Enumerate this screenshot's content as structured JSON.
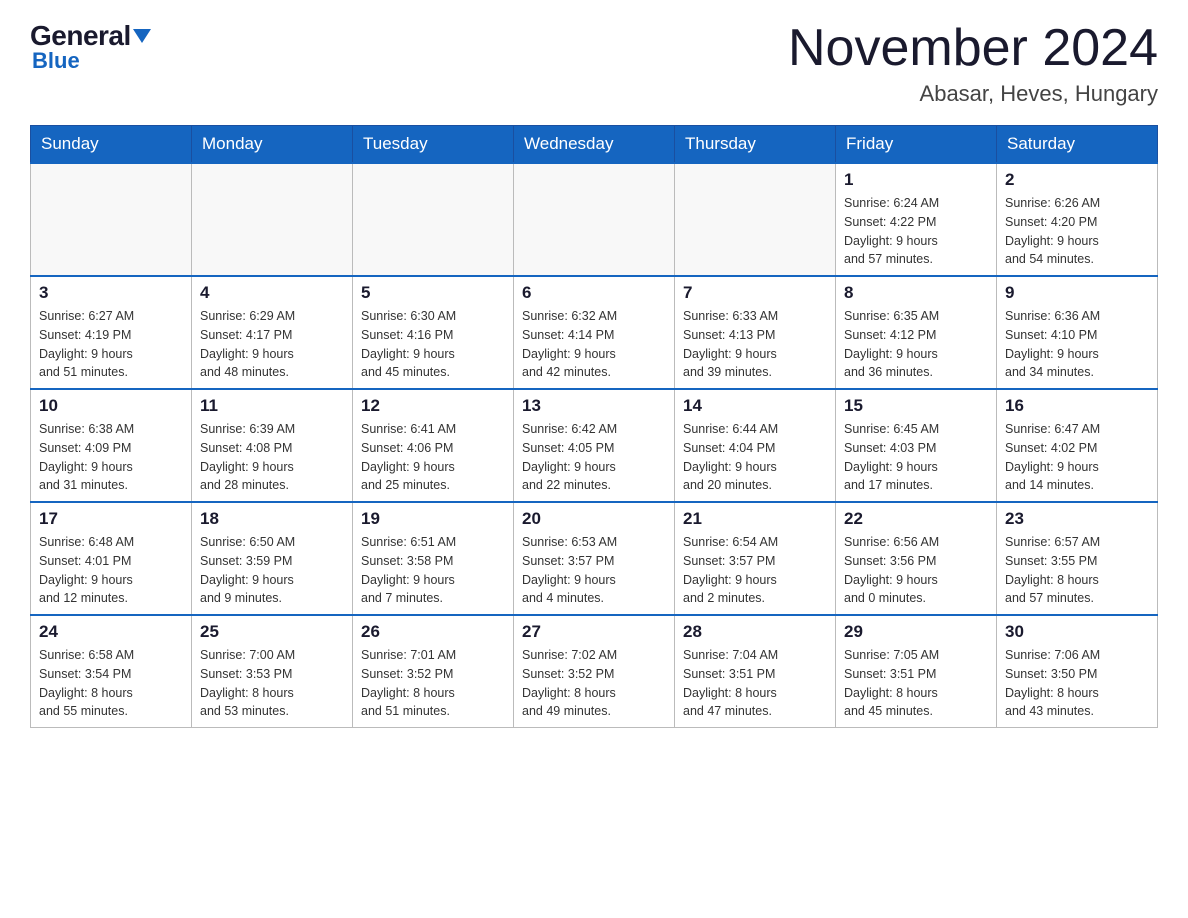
{
  "header": {
    "logo_general": "General",
    "logo_blue": "Blue",
    "month_title": "November 2024",
    "location": "Abasar, Heves, Hungary"
  },
  "days_of_week": [
    "Sunday",
    "Monday",
    "Tuesday",
    "Wednesday",
    "Thursday",
    "Friday",
    "Saturday"
  ],
  "weeks": [
    [
      {
        "day": "",
        "info": ""
      },
      {
        "day": "",
        "info": ""
      },
      {
        "day": "",
        "info": ""
      },
      {
        "day": "",
        "info": ""
      },
      {
        "day": "",
        "info": ""
      },
      {
        "day": "1",
        "info": "Sunrise: 6:24 AM\nSunset: 4:22 PM\nDaylight: 9 hours\nand 57 minutes."
      },
      {
        "day": "2",
        "info": "Sunrise: 6:26 AM\nSunset: 4:20 PM\nDaylight: 9 hours\nand 54 minutes."
      }
    ],
    [
      {
        "day": "3",
        "info": "Sunrise: 6:27 AM\nSunset: 4:19 PM\nDaylight: 9 hours\nand 51 minutes."
      },
      {
        "day": "4",
        "info": "Sunrise: 6:29 AM\nSunset: 4:17 PM\nDaylight: 9 hours\nand 48 minutes."
      },
      {
        "day": "5",
        "info": "Sunrise: 6:30 AM\nSunset: 4:16 PM\nDaylight: 9 hours\nand 45 minutes."
      },
      {
        "day": "6",
        "info": "Sunrise: 6:32 AM\nSunset: 4:14 PM\nDaylight: 9 hours\nand 42 minutes."
      },
      {
        "day": "7",
        "info": "Sunrise: 6:33 AM\nSunset: 4:13 PM\nDaylight: 9 hours\nand 39 minutes."
      },
      {
        "day": "8",
        "info": "Sunrise: 6:35 AM\nSunset: 4:12 PM\nDaylight: 9 hours\nand 36 minutes."
      },
      {
        "day": "9",
        "info": "Sunrise: 6:36 AM\nSunset: 4:10 PM\nDaylight: 9 hours\nand 34 minutes."
      }
    ],
    [
      {
        "day": "10",
        "info": "Sunrise: 6:38 AM\nSunset: 4:09 PM\nDaylight: 9 hours\nand 31 minutes."
      },
      {
        "day": "11",
        "info": "Sunrise: 6:39 AM\nSunset: 4:08 PM\nDaylight: 9 hours\nand 28 minutes."
      },
      {
        "day": "12",
        "info": "Sunrise: 6:41 AM\nSunset: 4:06 PM\nDaylight: 9 hours\nand 25 minutes."
      },
      {
        "day": "13",
        "info": "Sunrise: 6:42 AM\nSunset: 4:05 PM\nDaylight: 9 hours\nand 22 minutes."
      },
      {
        "day": "14",
        "info": "Sunrise: 6:44 AM\nSunset: 4:04 PM\nDaylight: 9 hours\nand 20 minutes."
      },
      {
        "day": "15",
        "info": "Sunrise: 6:45 AM\nSunset: 4:03 PM\nDaylight: 9 hours\nand 17 minutes."
      },
      {
        "day": "16",
        "info": "Sunrise: 6:47 AM\nSunset: 4:02 PM\nDaylight: 9 hours\nand 14 minutes."
      }
    ],
    [
      {
        "day": "17",
        "info": "Sunrise: 6:48 AM\nSunset: 4:01 PM\nDaylight: 9 hours\nand 12 minutes."
      },
      {
        "day": "18",
        "info": "Sunrise: 6:50 AM\nSunset: 3:59 PM\nDaylight: 9 hours\nand 9 minutes."
      },
      {
        "day": "19",
        "info": "Sunrise: 6:51 AM\nSunset: 3:58 PM\nDaylight: 9 hours\nand 7 minutes."
      },
      {
        "day": "20",
        "info": "Sunrise: 6:53 AM\nSunset: 3:57 PM\nDaylight: 9 hours\nand 4 minutes."
      },
      {
        "day": "21",
        "info": "Sunrise: 6:54 AM\nSunset: 3:57 PM\nDaylight: 9 hours\nand 2 minutes."
      },
      {
        "day": "22",
        "info": "Sunrise: 6:56 AM\nSunset: 3:56 PM\nDaylight: 9 hours\nand 0 minutes."
      },
      {
        "day": "23",
        "info": "Sunrise: 6:57 AM\nSunset: 3:55 PM\nDaylight: 8 hours\nand 57 minutes."
      }
    ],
    [
      {
        "day": "24",
        "info": "Sunrise: 6:58 AM\nSunset: 3:54 PM\nDaylight: 8 hours\nand 55 minutes."
      },
      {
        "day": "25",
        "info": "Sunrise: 7:00 AM\nSunset: 3:53 PM\nDaylight: 8 hours\nand 53 minutes."
      },
      {
        "day": "26",
        "info": "Sunrise: 7:01 AM\nSunset: 3:52 PM\nDaylight: 8 hours\nand 51 minutes."
      },
      {
        "day": "27",
        "info": "Sunrise: 7:02 AM\nSunset: 3:52 PM\nDaylight: 8 hours\nand 49 minutes."
      },
      {
        "day": "28",
        "info": "Sunrise: 7:04 AM\nSunset: 3:51 PM\nDaylight: 8 hours\nand 47 minutes."
      },
      {
        "day": "29",
        "info": "Sunrise: 7:05 AM\nSunset: 3:51 PM\nDaylight: 8 hours\nand 45 minutes."
      },
      {
        "day": "30",
        "info": "Sunrise: 7:06 AM\nSunset: 3:50 PM\nDaylight: 8 hours\nand 43 minutes."
      }
    ]
  ]
}
